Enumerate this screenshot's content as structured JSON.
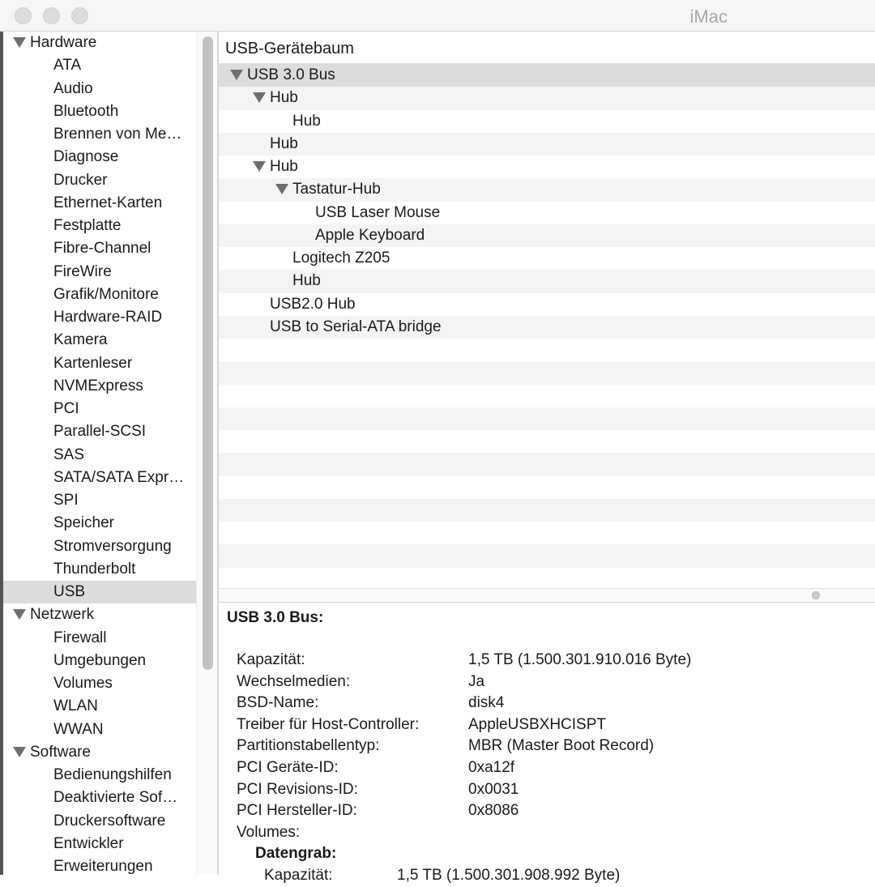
{
  "window": {
    "title": "iMac"
  },
  "sidebar": [
    {
      "label": "Hardware",
      "type": "cat"
    },
    {
      "label": "ATA"
    },
    {
      "label": "Audio"
    },
    {
      "label": "Bluetooth"
    },
    {
      "label": "Brennen von Me…"
    },
    {
      "label": "Diagnose"
    },
    {
      "label": "Drucker"
    },
    {
      "label": "Ethernet-Karten"
    },
    {
      "label": "Festplatte"
    },
    {
      "label": "Fibre-Channel"
    },
    {
      "label": "FireWire"
    },
    {
      "label": "Grafik/Monitore"
    },
    {
      "label": "Hardware-RAID"
    },
    {
      "label": "Kamera"
    },
    {
      "label": "Kartenleser"
    },
    {
      "label": "NVMExpress"
    },
    {
      "label": "PCI"
    },
    {
      "label": "Parallel-SCSI"
    },
    {
      "label": "SAS"
    },
    {
      "label": "SATA/SATA Expr…"
    },
    {
      "label": "SPI"
    },
    {
      "label": "Speicher"
    },
    {
      "label": "Stromversorgung"
    },
    {
      "label": "Thunderbolt"
    },
    {
      "label": "USB",
      "selected": true
    },
    {
      "label": "Netzwerk",
      "type": "cat"
    },
    {
      "label": "Firewall"
    },
    {
      "label": "Umgebungen"
    },
    {
      "label": "Volumes"
    },
    {
      "label": "WLAN"
    },
    {
      "label": "WWAN"
    },
    {
      "label": "Software",
      "type": "cat"
    },
    {
      "label": "Bedienungshilfen"
    },
    {
      "label": "Deaktivierte Sof…"
    },
    {
      "label": "Druckersoftware"
    },
    {
      "label": "Entwickler"
    },
    {
      "label": "Erweiterungen"
    }
  ],
  "tree": {
    "header": "USB-Gerätebaum",
    "rows": [
      {
        "label": "USB 3.0 Bus",
        "level": 0,
        "expanded": true,
        "selected": true
      },
      {
        "label": "Hub",
        "level": 1,
        "expanded": true
      },
      {
        "label": "Hub",
        "level": 2
      },
      {
        "label": "Hub",
        "level": 1
      },
      {
        "label": "Hub",
        "level": 1,
        "expanded": true
      },
      {
        "label": "Tastatur-Hub",
        "level": 2,
        "expanded": true
      },
      {
        "label": "USB Laser Mouse",
        "level": 3
      },
      {
        "label": "Apple Keyboard",
        "level": 3
      },
      {
        "label": "Logitech Z205",
        "level": 2
      },
      {
        "label": "Hub",
        "level": 2
      },
      {
        "label": "USB2.0 Hub",
        "level": 1
      },
      {
        "label": "USB to Serial-ATA bridge",
        "level": 1
      }
    ]
  },
  "detail": {
    "title": "USB 3.0 Bus:",
    "props": [
      {
        "k": "Kapazität:",
        "v": "1,5 TB (1.500.301.910.016 Byte)"
      },
      {
        "k": "Wechselmedien:",
        "v": "Ja"
      },
      {
        "k": "BSD-Name:",
        "v": "disk4"
      },
      {
        "k": "Treiber für Host-Controller:",
        "v": "AppleUSBXHCISPT"
      },
      {
        "k": "Partitionstabellentyp:",
        "v": "MBR (Master Boot Record)"
      },
      {
        "k": "PCI Geräte-ID:",
        "v": "0xa12f"
      },
      {
        "k": "PCI Revisions-ID:",
        "v": "0x0031"
      },
      {
        "k": "PCI Hersteller-ID:",
        "v": "0x8086"
      },
      {
        "k": "Volumes:",
        "v": ""
      }
    ],
    "volume": {
      "name": "Datengrab:",
      "k": "Kapazität:",
      "v": "1,5 TB (1.500.301.908.992 Byte)"
    }
  }
}
